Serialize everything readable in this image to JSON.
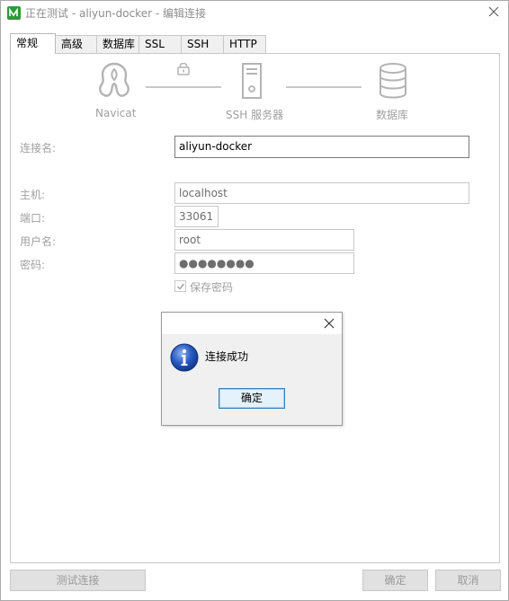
{
  "window": {
    "title": "正在测试 - aliyun-docker - 编辑连接"
  },
  "tabs": [
    {
      "label": "常规",
      "active": true
    },
    {
      "label": "高级",
      "active": false
    },
    {
      "label": "数据库",
      "active": false
    },
    {
      "label": "SSL",
      "active": false
    },
    {
      "label": "SSH",
      "active": false
    },
    {
      "label": "HTTP",
      "active": false
    }
  ],
  "diagram": {
    "client_label": "Navicat",
    "ssh_label": "SSH 服务器",
    "db_label": "数据库"
  },
  "form": {
    "connection_name_label": "连接名:",
    "connection_name_value": "aliyun-docker",
    "host_label": "主机:",
    "host_value": "localhost",
    "port_label": "端口:",
    "port_value": "33061",
    "user_label": "用户名:",
    "user_value": "root",
    "password_label": "密码:",
    "password_mask": "●●●●●●●●",
    "save_password_label": "保存密码",
    "save_password_checked": true
  },
  "dialog": {
    "message": "连接成功",
    "ok_label": "确定",
    "icon": "info-icon"
  },
  "footer": {
    "test_label": "测试连接",
    "ok_label": "确定",
    "cancel_label": "取消"
  },
  "colors": {
    "navicat_brand": "#2e9a3b",
    "info_blue": "#1f4fb5",
    "ok_button_border": "#3c7fb1"
  }
}
